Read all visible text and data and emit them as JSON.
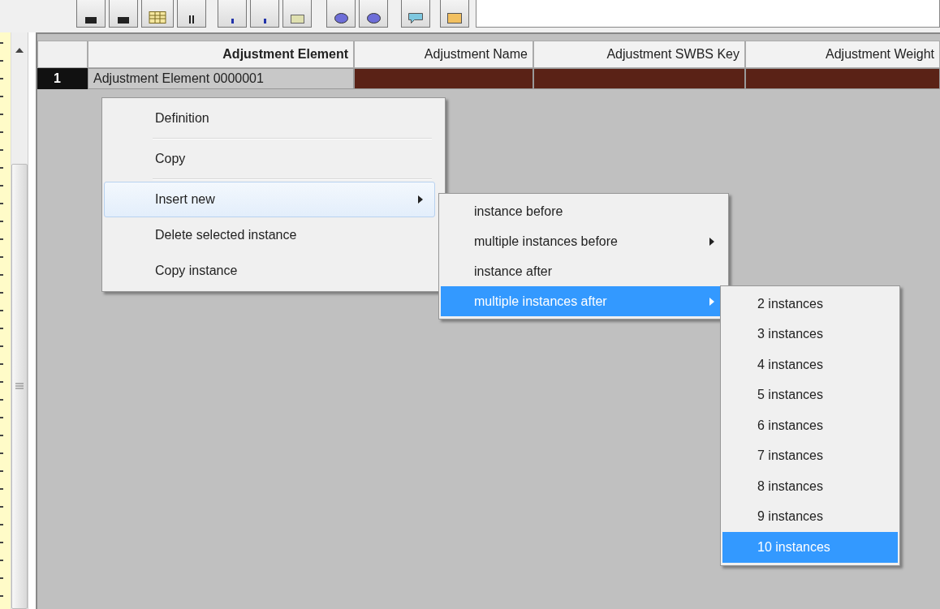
{
  "grid": {
    "columns": [
      {
        "label": "Adjustment Element",
        "bold": true
      },
      {
        "label": "Adjustment Name",
        "bold": false
      },
      {
        "label": "Adjustment SWBS Key",
        "bold": false
      },
      {
        "label": "Adjustment Weight",
        "bold": false
      }
    ],
    "rows": [
      {
        "number": "1",
        "selected": true,
        "cells": [
          "Adjustment Element 0000001",
          "",
          "",
          ""
        ]
      }
    ]
  },
  "context_menu": {
    "items": [
      {
        "kind": "item",
        "label": "Definition",
        "hovered": false,
        "selected": false,
        "submenu": false
      },
      {
        "kind": "separator"
      },
      {
        "kind": "item",
        "label": "Copy",
        "hovered": false,
        "selected": false,
        "submenu": false
      },
      {
        "kind": "separator"
      },
      {
        "kind": "item",
        "label": "Insert new",
        "hovered": true,
        "selected": false,
        "submenu": true
      },
      {
        "kind": "item",
        "label": "Delete selected instance",
        "hovered": false,
        "selected": false,
        "submenu": false
      },
      {
        "kind": "item",
        "label": "Copy instance",
        "hovered": false,
        "selected": false,
        "submenu": false
      }
    ]
  },
  "insert_submenu": {
    "items": [
      {
        "kind": "item",
        "label": "instance before",
        "hovered": false,
        "selected": false,
        "submenu": false
      },
      {
        "kind": "item",
        "label": "multiple instances before",
        "hovered": false,
        "selected": false,
        "submenu": true
      },
      {
        "kind": "item",
        "label": "instance after",
        "hovered": false,
        "selected": false,
        "submenu": false
      },
      {
        "kind": "item",
        "label": "multiple instances after",
        "hovered": false,
        "selected": true,
        "submenu": true
      }
    ]
  },
  "count_submenu": {
    "items": [
      {
        "kind": "item",
        "label": "2 instances",
        "hovered": false,
        "selected": false,
        "submenu": false
      },
      {
        "kind": "item",
        "label": "3 instances",
        "hovered": false,
        "selected": false,
        "submenu": false
      },
      {
        "kind": "item",
        "label": "4 instances",
        "hovered": false,
        "selected": false,
        "submenu": false
      },
      {
        "kind": "item",
        "label": "5 instances",
        "hovered": false,
        "selected": false,
        "submenu": false
      },
      {
        "kind": "item",
        "label": "6 instances",
        "hovered": false,
        "selected": false,
        "submenu": false
      },
      {
        "kind": "item",
        "label": "7 instances",
        "hovered": false,
        "selected": false,
        "submenu": false
      },
      {
        "kind": "item",
        "label": "8 instances",
        "hovered": false,
        "selected": false,
        "submenu": false
      },
      {
        "kind": "item",
        "label": "9 instances",
        "hovered": false,
        "selected": false,
        "submenu": false
      },
      {
        "kind": "item",
        "label": "10 instances",
        "hovered": false,
        "selected": true,
        "submenu": false
      }
    ]
  }
}
